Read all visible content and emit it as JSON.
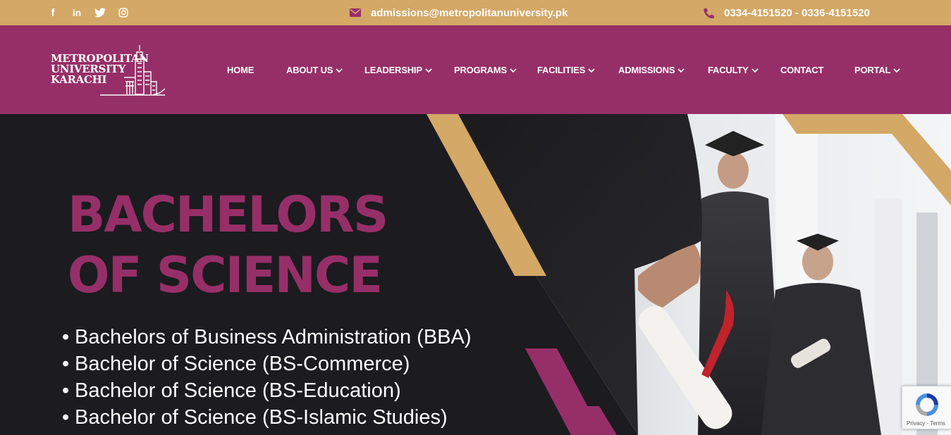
{
  "topbar": {
    "social": [
      {
        "icon": "facebook-icon",
        "glyph": "f"
      },
      {
        "icon": "linkedin-icon",
        "glyph": "in"
      },
      {
        "icon": "twitter-icon",
        "glyph": ""
      },
      {
        "icon": "instagram-icon",
        "glyph": ""
      }
    ],
    "email": "admissions@metropolitanuniversity.pk",
    "phone": "0334-4151520 - 0336-4151520",
    "background": "#d4a866"
  },
  "logo": {
    "line1": "METROPOLITAN",
    "line2": "UNIVERSITY",
    "line3": "KARACHI"
  },
  "nav": {
    "background": "#962f68",
    "items": [
      {
        "label": "HOME",
        "dropdown": false
      },
      {
        "label": "ABOUT US",
        "dropdown": true
      },
      {
        "label": "LEADERSHIP",
        "dropdown": true
      },
      {
        "label": "PROGRAMS",
        "dropdown": true
      },
      {
        "label": "FACILITIES",
        "dropdown": true
      },
      {
        "label": "ADMISSIONS",
        "dropdown": true
      },
      {
        "label": "FACULTY",
        "dropdown": true
      },
      {
        "label": "CONTACT",
        "dropdown": false
      },
      {
        "label": "PORTAL",
        "dropdown": true
      }
    ]
  },
  "hero": {
    "title_line1": "BACHELORS",
    "title_line2": "OF SCIENCE",
    "programs": [
      "Bachelors of Business Administration (BBA)",
      "Bachelor of Science (BS-Commerce)",
      "Bachelor of Science (BS-Education)",
      "Bachelor of Science (BS-Islamic Studies)"
    ],
    "accent_purple": "#962f68",
    "accent_gold": "#d4a866",
    "dark": "#1c1b20"
  },
  "recaptcha": {
    "terms": "Privacy - Terms"
  }
}
